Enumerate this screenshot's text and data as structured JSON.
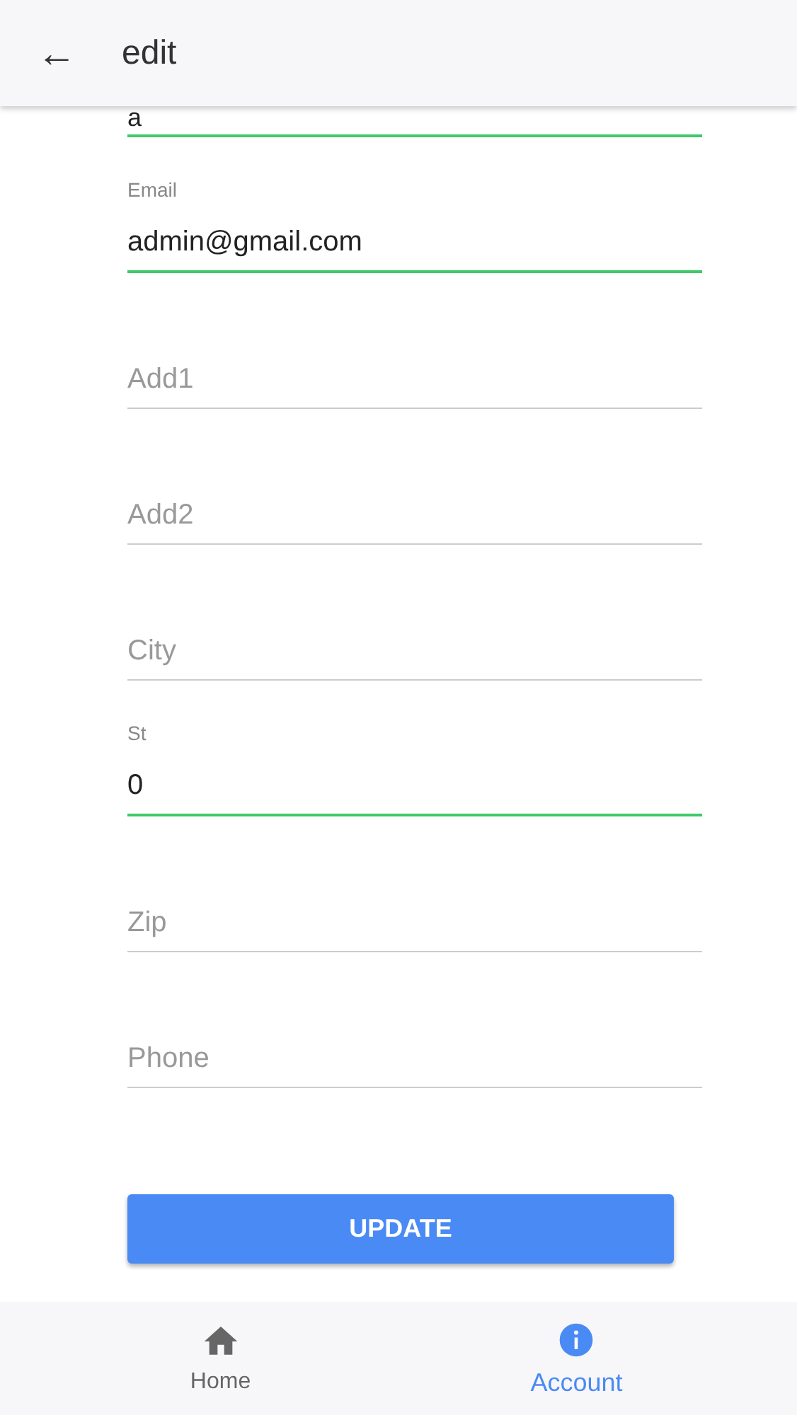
{
  "header": {
    "back_icon": "←",
    "title": "edit"
  },
  "fields": [
    {
      "value": "a",
      "valid": true
    },
    {
      "label": "Email",
      "value": "admin@gmail.com",
      "valid": true
    },
    {
      "placeholder": "Add1",
      "valid": false
    },
    {
      "placeholder": "Add2",
      "valid": false
    },
    {
      "placeholder": "City",
      "valid": false
    },
    {
      "label": "St",
      "value": "0",
      "valid": true
    },
    {
      "placeholder": "Zip",
      "valid": false
    },
    {
      "placeholder": "Phone",
      "valid": false
    }
  ],
  "button": "UPDATE",
  "nav": [
    {
      "label": "Home",
      "kind": "home",
      "selected": false
    },
    {
      "label": "Account",
      "kind": "info",
      "selected": true
    }
  ]
}
